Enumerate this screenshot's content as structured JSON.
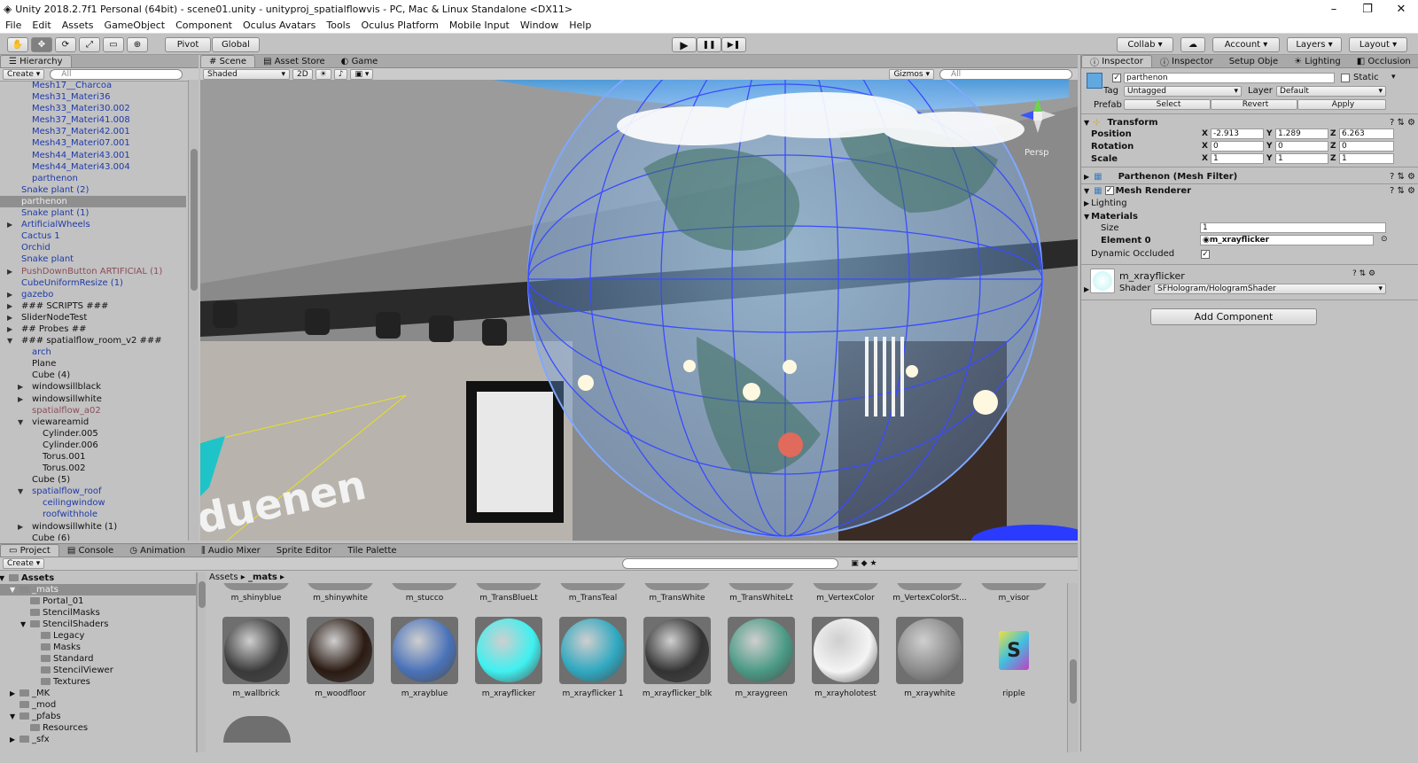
{
  "window": {
    "title": "Unity 2018.2.7f1 Personal (64bit) - scene01.unity - unityproj_spatialflowvis - PC, Mac & Linux Standalone <DX11>",
    "minimize": "–",
    "maximize": "❐",
    "close": "✕"
  },
  "menu": [
    "File",
    "Edit",
    "Assets",
    "GameObject",
    "Component",
    "Oculus Avatars",
    "Tools",
    "Oculus Platform",
    "Mobile Input",
    "Window",
    "Help"
  ],
  "toolbar": {
    "tools": [
      "✋",
      "✥",
      "⟳",
      "⤢",
      "▭",
      "⊕"
    ],
    "pivot": "Pivot",
    "global": "Global",
    "play": "▶",
    "pause": "❚❚",
    "step": "▶❚",
    "collab": "Collab",
    "account": "Account",
    "layers": "Layers",
    "layout": "Layout"
  },
  "hierarchy": {
    "tab": "Hierarchy",
    "create": "Create",
    "search_placeholder": "All",
    "items": [
      {
        "label": "Mesh17__Charcoa",
        "indent": 2,
        "style": "blue",
        "arrow": ""
      },
      {
        "label": "Mesh31_Materi36",
        "indent": 2,
        "style": "blue",
        "arrow": ""
      },
      {
        "label": "Mesh33_Materi30.002",
        "indent": 2,
        "style": "blue",
        "arrow": ""
      },
      {
        "label": "Mesh37_Materi41.008",
        "indent": 2,
        "style": "blue",
        "arrow": ""
      },
      {
        "label": "Mesh37_Materi42.001",
        "indent": 2,
        "style": "blue",
        "arrow": ""
      },
      {
        "label": "Mesh43_Materi07.001",
        "indent": 2,
        "style": "blue",
        "arrow": ""
      },
      {
        "label": "Mesh44_Materi43.001",
        "indent": 2,
        "style": "blue",
        "arrow": ""
      },
      {
        "label": "Mesh44_Materi43.004",
        "indent": 2,
        "style": "blue",
        "arrow": ""
      },
      {
        "label": "parthenon",
        "indent": 2,
        "style": "blue",
        "arrow": ""
      },
      {
        "label": "Snake plant (2)",
        "indent": 1,
        "style": "blue",
        "arrow": ""
      },
      {
        "label": "parthenon",
        "indent": 1,
        "style": "sel",
        "arrow": ""
      },
      {
        "label": "Snake plant (1)",
        "indent": 1,
        "style": "blue",
        "arrow": ""
      },
      {
        "label": "ArtificialWheels",
        "indent": 1,
        "style": "blue",
        "arrow": "▶"
      },
      {
        "label": "Cactus 1",
        "indent": 1,
        "style": "blue",
        "arrow": ""
      },
      {
        "label": "Orchid",
        "indent": 1,
        "style": "blue",
        "arrow": ""
      },
      {
        "label": "Snake plant",
        "indent": 1,
        "style": "blue",
        "arrow": ""
      },
      {
        "label": "PushDownButton ARTIFICIAL (1)",
        "indent": 1,
        "style": "pink",
        "arrow": "▶"
      },
      {
        "label": "CubeUniformResize (1)",
        "indent": 1,
        "style": "blue",
        "arrow": ""
      },
      {
        "label": "gazebo",
        "indent": 1,
        "style": "blue",
        "arrow": "▶"
      },
      {
        "label": "### SCRIPTS ###",
        "indent": 1,
        "style": "",
        "arrow": "▶"
      },
      {
        "label": "SliderNodeTest",
        "indent": 1,
        "style": "",
        "arrow": "▶"
      },
      {
        "label": "## Probes ##",
        "indent": 1,
        "style": "",
        "arrow": "▶"
      },
      {
        "label": "### spatialflow_room_v2 ###",
        "indent": 1,
        "style": "",
        "arrow": "▼"
      },
      {
        "label": "arch",
        "indent": 2,
        "style": "blue",
        "arrow": ""
      },
      {
        "label": "Plane",
        "indent": 2,
        "style": "",
        "arrow": ""
      },
      {
        "label": "Cube (4)",
        "indent": 2,
        "style": "",
        "arrow": ""
      },
      {
        "label": "windowsillblack",
        "indent": 2,
        "style": "",
        "arrow": "▶"
      },
      {
        "label": "windowsillwhite",
        "indent": 2,
        "style": "",
        "arrow": "▶"
      },
      {
        "label": "spatialflow_a02",
        "indent": 2,
        "style": "pink",
        "arrow": ""
      },
      {
        "label": "viewareamid",
        "indent": 2,
        "style": "",
        "arrow": "▼"
      },
      {
        "label": "Cylinder.005",
        "indent": 3,
        "style": "",
        "arrow": ""
      },
      {
        "label": "Cylinder.006",
        "indent": 3,
        "style": "",
        "arrow": ""
      },
      {
        "label": "Torus.001",
        "indent": 3,
        "style": "",
        "arrow": ""
      },
      {
        "label": "Torus.002",
        "indent": 3,
        "style": "",
        "arrow": ""
      },
      {
        "label": "Cube (5)",
        "indent": 2,
        "style": "",
        "arrow": ""
      },
      {
        "label": "spatialflow_roof",
        "indent": 2,
        "style": "blue",
        "arrow": "▼"
      },
      {
        "label": "ceilingwindow",
        "indent": 3,
        "style": "blue",
        "arrow": ""
      },
      {
        "label": "roofwithhole",
        "indent": 3,
        "style": "blue",
        "arrow": ""
      },
      {
        "label": "windowsillwhite (1)",
        "indent": 2,
        "style": "",
        "arrow": "▶"
      },
      {
        "label": "Cube (6)",
        "indent": 2,
        "style": "",
        "arrow": ""
      }
    ]
  },
  "scene": {
    "tabs": [
      "Scene",
      "Asset Store",
      "Game"
    ],
    "shading": "Shaded",
    "mode2d": "2D",
    "gizmos": "Gizmos",
    "search_placeholder": "All",
    "persp": "Persp",
    "wall_text": "duenen"
  },
  "inspector": {
    "tabs": [
      "Inspector",
      "Inspector",
      "Setup Obje",
      "Lighting",
      "Occlusion"
    ],
    "object_name": "parthenon",
    "static_label": "Static",
    "tag_label": "Tag",
    "tag_value": "Untagged",
    "layer_label": "Layer",
    "layer_value": "Default",
    "prefab_label": "Prefab",
    "prefab_select": "Select",
    "prefab_revert": "Revert",
    "prefab_apply": "Apply",
    "transform": {
      "title": "Transform",
      "position_label": "Position",
      "rotation_label": "Rotation",
      "scale_label": "Scale",
      "position": {
        "x": "-2.913",
        "y": "1.289",
        "z": "6.263"
      },
      "rotation": {
        "x": "0",
        "y": "0",
        "z": "0"
      },
      "scale": {
        "x": "1",
        "y": "1",
        "z": "1"
      }
    },
    "axis": {
      "x": "X",
      "y": "Y",
      "z": "Z"
    },
    "mesh_filter": "Parthenon (Mesh Filter)",
    "mesh_renderer": "Mesh Renderer",
    "lighting": "Lighting",
    "materials": "Materials",
    "size_label": "Size",
    "size_value": "1",
    "element0_label": "Element 0",
    "element0_value": "m_xrayflicker",
    "dynamic_occluded": "Dynamic Occluded",
    "material_name": "m_xrayflicker",
    "shader_label": "Shader",
    "shader_value": "SFHologram/HologramShader",
    "add_component": "Add Component"
  },
  "project": {
    "tabs": [
      "Project",
      "Console",
      "Animation",
      "Audio Mixer",
      "Sprite Editor",
      "Tile Palette"
    ],
    "create": "Create",
    "breadcrumb": [
      "Assets",
      "_mats"
    ],
    "tree": [
      {
        "label": "Assets",
        "indent": 0,
        "arrow": "▼",
        "bold": true
      },
      {
        "label": "_mats",
        "indent": 1,
        "arrow": "▼",
        "sel": true
      },
      {
        "label": "Portal_01",
        "indent": 2,
        "arrow": ""
      },
      {
        "label": "StencilMasks",
        "indent": 2,
        "arrow": ""
      },
      {
        "label": "StencilShaders",
        "indent": 2,
        "arrow": "▼"
      },
      {
        "label": "Legacy",
        "indent": 3,
        "arrow": ""
      },
      {
        "label": "Masks",
        "indent": 3,
        "arrow": ""
      },
      {
        "label": "Standard",
        "indent": 3,
        "arrow": ""
      },
      {
        "label": "StencilViewer",
        "indent": 3,
        "arrow": ""
      },
      {
        "label": "Textures",
        "indent": 3,
        "arrow": ""
      },
      {
        "label": "_MK",
        "indent": 1,
        "arrow": "▶"
      },
      {
        "label": "_mod",
        "indent": 1,
        "arrow": ""
      },
      {
        "label": "_pfabs",
        "indent": 1,
        "arrow": "▼"
      },
      {
        "label": "Resources",
        "indent": 2,
        "arrow": ""
      },
      {
        "label": "_sfx",
        "indent": 1,
        "arrow": "▶"
      }
    ],
    "row1": [
      "m_shinyblue",
      "m_shinywhite",
      "m_stucco",
      "m_TransBlueLt",
      "m_TransTeal",
      "m_TransWhite",
      "m_TransWhiteLt",
      "m_VertexColor",
      "m_VertexColorSt...",
      "m_visor"
    ],
    "row2": [
      {
        "label": "m_wallbrick",
        "color": "#3a3a3a"
      },
      {
        "label": "m_woodfloor",
        "color": "#2a1a12"
      },
      {
        "label": "m_xrayblue",
        "color": "#4a72b8"
      },
      {
        "label": "m_xrayflicker",
        "color": "#3ff0f0"
      },
      {
        "label": "m_xrayflicker 1",
        "color": "#2fa8c0"
      },
      {
        "label": "m_xrayflicker_blk",
        "color": "#333333"
      },
      {
        "label": "m_xraygreen",
        "color": "#4a9a85"
      },
      {
        "label": "m_xrayholotest",
        "color": "#f4f4f4"
      },
      {
        "label": "m_xraywhite",
        "color": "#8a8a8a"
      },
      {
        "label": "ripple",
        "color": "script"
      }
    ],
    "script_glyph": "S"
  }
}
